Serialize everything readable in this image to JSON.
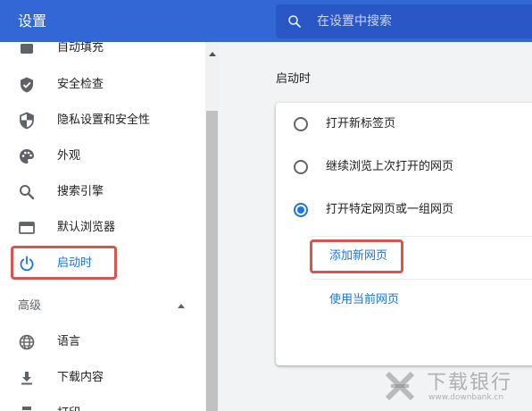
{
  "header": {
    "title": "设置",
    "search_placeholder": "在设置中搜索"
  },
  "sidebar": {
    "items": [
      {
        "label": "自动填充",
        "icon": "autofill-icon"
      },
      {
        "label": "安全检查",
        "icon": "shield-check-icon"
      },
      {
        "label": "隐私设置和安全性",
        "icon": "privacy-shield-icon"
      },
      {
        "label": "外观",
        "icon": "palette-icon"
      },
      {
        "label": "搜索引擎",
        "icon": "search-icon"
      },
      {
        "label": "默认浏览器",
        "icon": "browser-window-icon"
      },
      {
        "label": "启动时",
        "icon": "power-icon",
        "active": true
      }
    ],
    "advanced": {
      "label": "高级",
      "items": [
        {
          "label": "语言",
          "icon": "globe-icon"
        },
        {
          "label": "下载内容",
          "icon": "download-icon"
        },
        {
          "label": "打印",
          "icon": "printer-icon"
        }
      ]
    }
  },
  "main": {
    "section_title": "启动时",
    "options": [
      {
        "label": "打开新标签页",
        "checked": false
      },
      {
        "label": "继续浏览上次打开的网页",
        "checked": false
      },
      {
        "label": "打开特定网页或一组网页",
        "checked": true
      }
    ],
    "add_page_link": "添加新网页",
    "use_current_link": "使用当前网页"
  },
  "watermark": {
    "text": "下载银行",
    "url": "www.downbank.cn"
  },
  "colors": {
    "header": "#3367d6",
    "accent": "#1a73e8",
    "highlight_box": "#d9534f"
  }
}
